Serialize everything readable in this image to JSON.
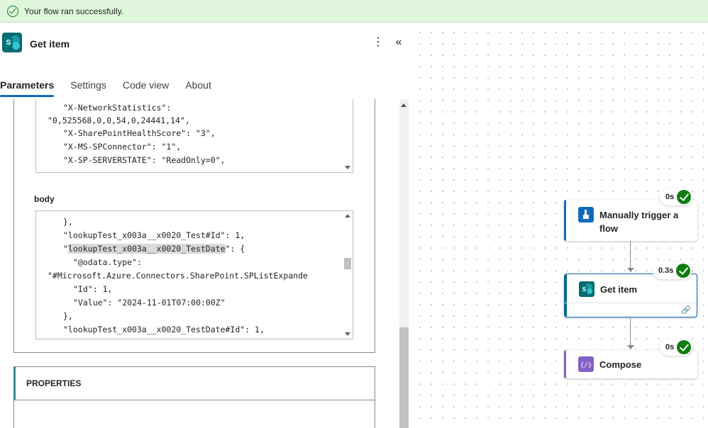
{
  "banner": {
    "message": "Your flow ran successfully.",
    "icon": "check-circle-icon"
  },
  "panel": {
    "title": "Get item",
    "icon": "sharepoint-icon",
    "more_icon": "more-vertical-icon",
    "collapse_icon": "chevron-double-left-icon",
    "tabs": [
      {
        "label": "Parameters",
        "active": true
      },
      {
        "label": "Settings",
        "active": false
      },
      {
        "label": "Code view",
        "active": false
      },
      {
        "label": "About",
        "active": false
      }
    ]
  },
  "headers_box": {
    "lines": [
      "\"X-NetworkStatistics\":",
      "\"0,525568,0,0,54,0,24441,14\",",
      "\"X-SharePointHealthScore\": \"3\",",
      "\"X-MS-SPConnector\": \"1\",",
      "\"X-SP-SERVERSTATE\": \"ReadOnly=0\","
    ]
  },
  "body_section": {
    "label": "body",
    "lines": [
      "},",
      "\"lookupTest_x003a__x0020_Test#Id\": 1,",
      "\"lookupTest_x003a__x0020_TestDate\": {",
      "\"@odata.type\":",
      "\"#Microsoft.Azure.Connectors.SharePoint.SPListExpande",
      "\"Id\": 1,",
      "\"Value\": \"2024-11-01T07:00:00Z\"",
      "},",
      "\"lookupTest_x003a__x0020_TestDate#Id\": 1,"
    ]
  },
  "properties": {
    "label": "PROPERTIES"
  },
  "flow": {
    "nodes": [
      {
        "label": "Manually trigger a flow",
        "duration": "0s",
        "accent": "#0f6cbd",
        "icon": "trigger-hand-icon"
      },
      {
        "label": "Get item",
        "duration": "0.3s",
        "accent": "#036c70",
        "icon": "sharepoint-icon",
        "footer_icon": "link-icon"
      },
      {
        "label": "Compose",
        "duration": "0s",
        "accent": "#8661c5",
        "icon": "compose-icon"
      }
    ]
  }
}
